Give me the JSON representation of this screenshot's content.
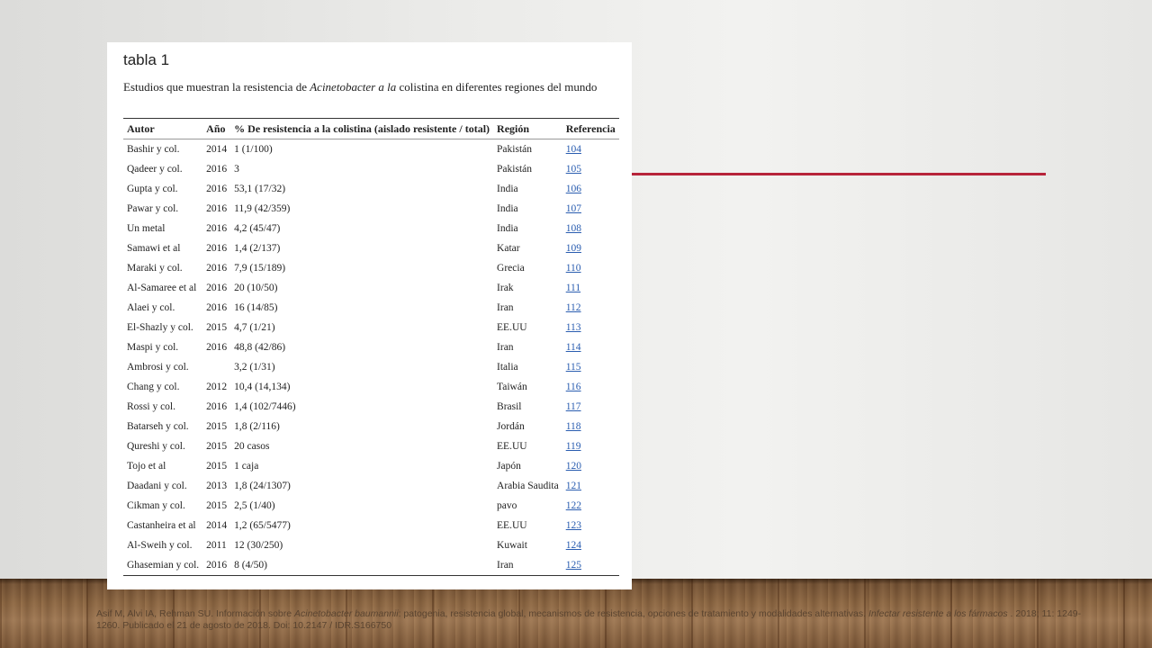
{
  "slide": {
    "accent_color": "#b7243a",
    "floor_color": "#8a6440"
  },
  "document": {
    "title": "tabla 1",
    "caption_pre": "Estudios que muestran la resistencia de ",
    "caption_italic": "Acinetobacter a la",
    "caption_post": " colistina en diferentes regiones del mundo",
    "columns": [
      "Autor",
      "Año",
      "% De resistencia a la colistina (aislado resistente / total)",
      "Región",
      "Referencia"
    ],
    "rows": [
      {
        "autor": "Bashir y col.",
        "ano": "2014",
        "res": "1 (1/100)",
        "region": "Pakistán",
        "ref": "104"
      },
      {
        "autor": "Qadeer y col.",
        "ano": "2016",
        "res": "3",
        "region": "Pakistán",
        "ref": "105"
      },
      {
        "autor": "Gupta y col.",
        "ano": "2016",
        "res": "53,1 (17/32)",
        "region": "India",
        "ref": "106"
      },
      {
        "autor": "Pawar y col.",
        "ano": "2016",
        "res": "11,9 (42/359)",
        "region": "India",
        "ref": "107"
      },
      {
        "autor": "Un metal",
        "ano": "2016",
        "res": "4,2 (45/47)",
        "region": "India",
        "ref": "108"
      },
      {
        "autor": "Samawi et al",
        "ano": "2016",
        "res": "1,4 (2/137)",
        "region": "Katar",
        "ref": "109"
      },
      {
        "autor": "Maraki y col.",
        "ano": "2016",
        "res": "7,9 (15/189)",
        "region": "Grecia",
        "ref": "110"
      },
      {
        "autor": "Al-Samaree et al",
        "ano": "2016",
        "res": "20 (10/50)",
        "region": "Irak",
        "ref": "111"
      },
      {
        "autor": "Alaei y col.",
        "ano": "2016",
        "res": "16 (14/85)",
        "region": "Iran",
        "ref": "112"
      },
      {
        "autor": "El-Shazly y col.",
        "ano": "2015",
        "res": "4,7 (1/21)",
        "region": "EE.UU",
        "ref": "113"
      },
      {
        "autor": "Maspi y col.",
        "ano": "2016",
        "res": "48,8 (42/86)",
        "region": "Iran",
        "ref": "114"
      },
      {
        "autor": "Ambrosi y col.",
        "ano": "",
        "res": "3,2 (1/31)",
        "region": "Italia",
        "ref": "115"
      },
      {
        "autor": "Chang y col.",
        "ano": "2012",
        "res": "10,4 (14,134)",
        "region": "Taiwán",
        "ref": "116"
      },
      {
        "autor": "Rossi y col.",
        "ano": "2016",
        "res": "1,4 (102/7446)",
        "region": "Brasil",
        "ref": "117"
      },
      {
        "autor": "Batarseh y col.",
        "ano": "2015",
        "res": "1,8 (2/116)",
        "region": "Jordán",
        "ref": "118"
      },
      {
        "autor": "Qureshi y col.",
        "ano": "2015",
        "res": "20 casos",
        "region": "EE.UU",
        "ref": "119"
      },
      {
        "autor": "Tojo et al",
        "ano": "2015",
        "res": "1 caja",
        "region": "Japón",
        "ref": "120"
      },
      {
        "autor": "Daadani y col.",
        "ano": "2013",
        "res": "1,8 (24/1307)",
        "region": "Arabia Saudita",
        "ref": "121"
      },
      {
        "autor": "Cikman y col.",
        "ano": "2015",
        "res": "2,5 (1/40)",
        "region": "pavo",
        "ref": "122"
      },
      {
        "autor": "Castanheira et al",
        "ano": "2014",
        "res": "1,2 (65/5477)",
        "region": "EE.UU",
        "ref": "123"
      },
      {
        "autor": "Al-Sweih y col.",
        "ano": "2011",
        "res": "12 (30/250)",
        "region": "Kuwait",
        "ref": "124"
      },
      {
        "autor": "Ghasemian y col.",
        "ano": "2016",
        "res": "8 (4/50)",
        "region": "Iran",
        "ref": "125"
      }
    ]
  },
  "citation": {
    "part1": "Asif M, Alvi IA, Rehman SU. Información sobre ",
    "italic1": "Acinetobacter baumannii",
    "part2": ": patogenia, resistencia global, mecanismos de resistencia, opciones de tratamiento y modalidades alternativas. ",
    "italic2": "Infectar resistente a los fármacos",
    "part3": " . 2018; 11: 1249-1260. Publicado el 21 de agosto de 2018. Doi: 10.2147 / IDR.S166750"
  }
}
